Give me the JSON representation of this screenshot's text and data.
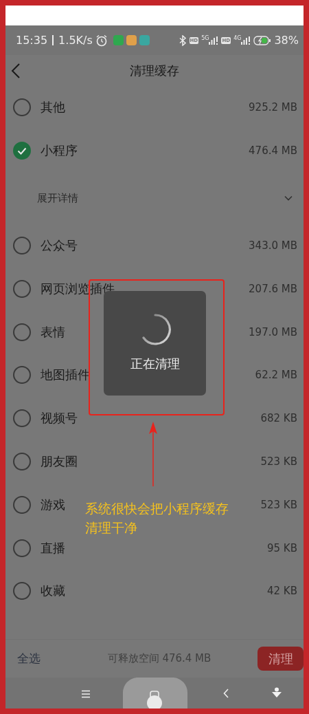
{
  "status_bar": {
    "time": "15:35",
    "speed": "1.5K/s",
    "hd_badges": [
      "HD",
      "HD"
    ],
    "networks": [
      "5G",
      "4G"
    ],
    "battery": "38%"
  },
  "header": {
    "title": "清理缓存"
  },
  "items": [
    {
      "kind": "item",
      "label": "其他",
      "size": "925.2 MB",
      "checked": false
    },
    {
      "kind": "item",
      "label": "小程序",
      "size": "476.4 MB",
      "checked": true
    },
    {
      "kind": "expander",
      "label": "展开详情"
    },
    {
      "kind": "item",
      "label": "公众号",
      "size": "343.0 MB",
      "checked": false
    },
    {
      "kind": "item",
      "label": "网页浏览插件",
      "size": "207.6 MB",
      "checked": false
    },
    {
      "kind": "item",
      "label": "表情",
      "size": "197.0 MB",
      "checked": false
    },
    {
      "kind": "item",
      "label": "地图插件",
      "size": "62.2 MB",
      "checked": false
    },
    {
      "kind": "item",
      "label": "视频号",
      "size": "682 KB",
      "checked": false
    },
    {
      "kind": "item",
      "label": "朋友圈",
      "size": "523 KB",
      "checked": false
    },
    {
      "kind": "item",
      "label": "游戏",
      "size": "523 KB",
      "checked": false
    },
    {
      "kind": "item",
      "label": "直播",
      "size": "95 KB",
      "checked": false
    },
    {
      "kind": "item",
      "label": "收藏",
      "size": "42 KB",
      "checked": false
    }
  ],
  "toast": {
    "text": "正在清理"
  },
  "annotation": {
    "caption_lines": [
      "系统很快会把小程序缓存",
      "清理干净"
    ]
  },
  "footer": {
    "select_all": "全选",
    "summary": "可释放空间 476.4 MB",
    "clean_button": "清理"
  }
}
